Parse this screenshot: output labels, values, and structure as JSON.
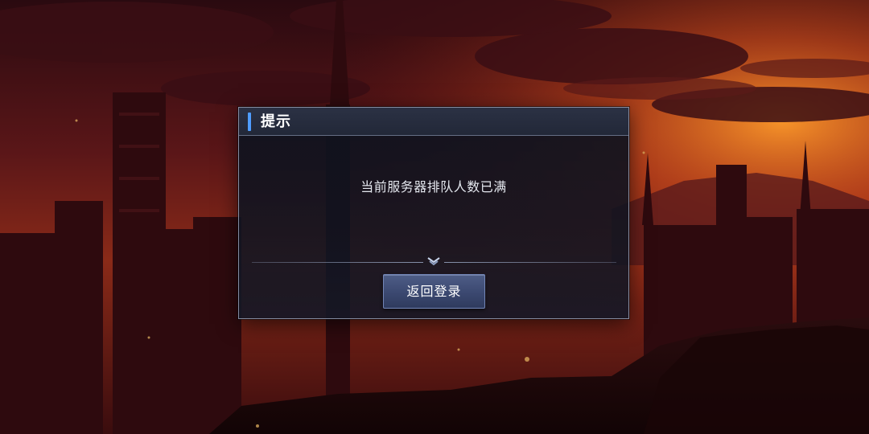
{
  "dialog": {
    "title": "提示",
    "message": "当前服务器排队人数已满",
    "button_label": "返回登录",
    "divider_icon": "double-chevron-down-icon"
  },
  "colors": {
    "title_accent": "#4f9dff",
    "dialog_border": "#aab4cd",
    "button_fill": "#3b4870"
  }
}
